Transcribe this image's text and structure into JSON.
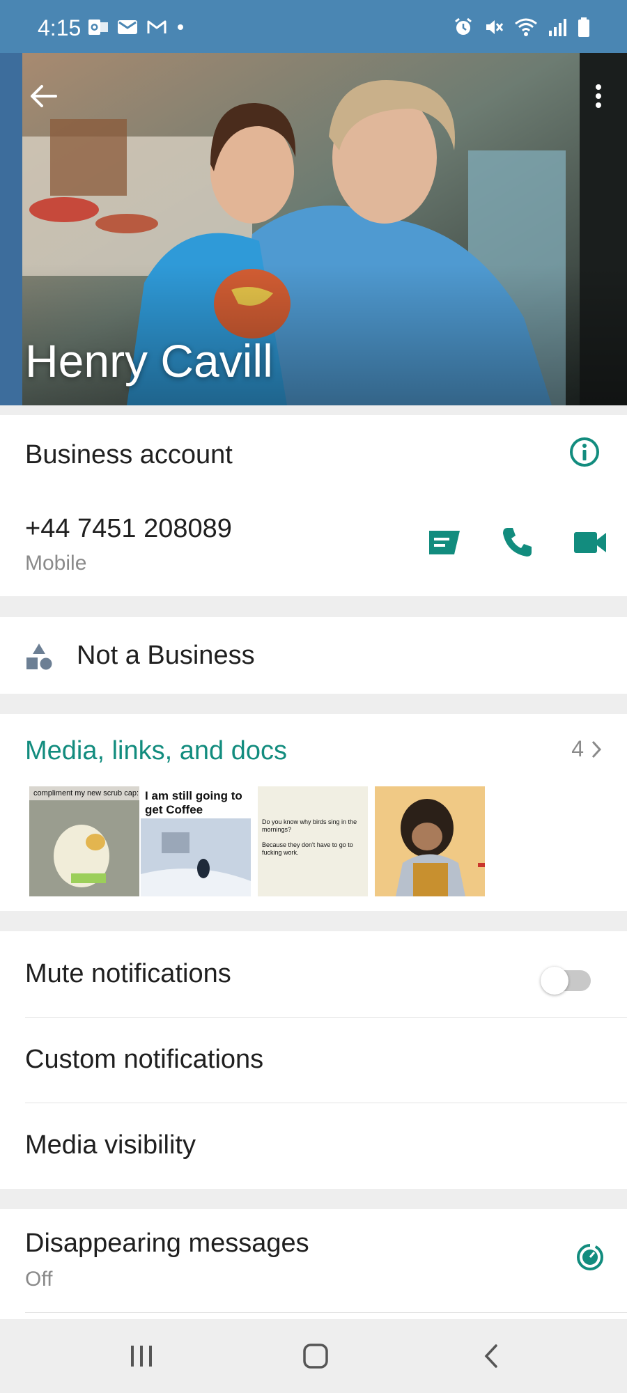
{
  "status_bar": {
    "time": "4:15",
    "left_icons": [
      "outlook-icon",
      "mail-icon",
      "gmail-icon",
      "dot-icon"
    ],
    "right_icons": [
      "alarm-icon",
      "mute-icon",
      "wifi-icon",
      "signal-icon",
      "battery-icon"
    ]
  },
  "header": {
    "name": "Henry Cavill",
    "back_icon": "arrow-left-icon",
    "menu_icon": "more-vertical-icon"
  },
  "contact": {
    "business_label": "Business account",
    "phone": "+44 7451 208089",
    "phone_type": "Mobile"
  },
  "business": {
    "label": "Not a Business"
  },
  "media": {
    "title": "Media, links, and docs",
    "count": "4",
    "thumbs": [
      {
        "caption": "compliment my new scrub cap:"
      },
      {
        "caption": "I am still going to get Coffee"
      },
      {
        "caption": "Do you know why birds sing in the mornings?\n\nBecause they don't have to go to fucking work."
      },
      {
        "caption": ""
      }
    ]
  },
  "notifications": {
    "mute_label": "Mute notifications",
    "mute_on": false,
    "custom_label": "Custom notifications",
    "visibility_label": "Media visibility"
  },
  "disappearing": {
    "label": "Disappearing messages",
    "value": "Off"
  },
  "colors": {
    "accent": "#128c7e",
    "status_bar": "#4a86b3"
  }
}
